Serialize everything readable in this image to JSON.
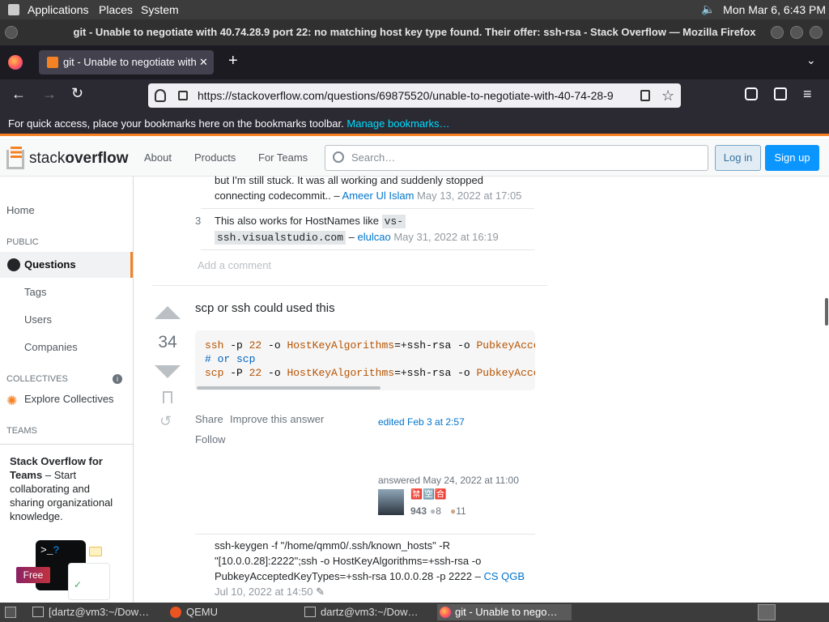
{
  "os_panel": {
    "applications": "Applications",
    "places": "Places",
    "system": "System",
    "clock": "Mon Mar  6,  6:43 PM"
  },
  "window": {
    "title": "git - Unable to negotiate with 40.74.28.9 port 22: no matching host key type found. Their offer: ssh-rsa - Stack Overflow — Mozilla Firefox"
  },
  "browser": {
    "tab_title": "git - Unable to negotiate with",
    "url": "https://stackoverflow.com/questions/69875520/unable-to-negotiate-with-40-74-28-9",
    "bookmark_hint": "For quick access, place your bookmarks here on the bookmarks toolbar.",
    "bookmark_link": "Manage bookmarks…"
  },
  "so": {
    "logo_a": "stack",
    "logo_b": "overflow",
    "nav": [
      "About",
      "Products",
      "For Teams"
    ],
    "search_placeholder": "Search…",
    "login": "Log in",
    "signup": "Sign up"
  },
  "leftnav": {
    "home": "Home",
    "public": "PUBLIC",
    "questions": "Questions",
    "tags": "Tags",
    "users": "Users",
    "companies": "Companies",
    "collectives": "COLLECTIVES",
    "explore": "Explore Collectives",
    "teams": "TEAMS",
    "teams_title": "Stack Overflow for Teams",
    "teams_text": " – Start collaborating and sharing organizational knowledge.",
    "free": "Free"
  },
  "comments": [
    {
      "text_1": "but I'm still stuck. It was all working and suddenly stopped",
      "text_2": "connecting codecommit.. –",
      "user": "Ameer Ul Islam",
      "date": "May 13, 2022 at 17:05"
    },
    {
      "score": "3",
      "text": "This also works for HostNames like",
      "code_1": "vs-",
      "code_2": "ssh.visualstudio.com",
      "dash": "–",
      "user": "elulcao",
      "date": "May 31, 2022 at 16:19"
    }
  ],
  "add_comment": "Add a comment",
  "answer": {
    "votes": "34",
    "intro": "scp or ssh could used this",
    "code_line1": {
      "a": "ssh",
      "b": " -p ",
      "c": "22",
      "d": " -o ",
      "e": "HostKeyAlgorithms",
      "f": "=+ssh-rsa -o ",
      "g": "PubkeyAcce"
    },
    "code_line2": "# or scp",
    "code_line3": {
      "a": "scp",
      "b": " -P ",
      "c": "22",
      "d": " -o ",
      "e": "HostKeyAlgorithms",
      "f": "=+ssh-rsa -o ",
      "g": "PubkeyAcce"
    },
    "share": "Share",
    "improve": "Improve this answer",
    "follow": "Follow",
    "edited": "edited Feb 3 at 2:57",
    "answered": "answered May 24, 2022 at 11:00",
    "user_glyph": "🈲🈳🈴",
    "rep": "943",
    "silver": "8",
    "bronze": "11"
  },
  "answer_comment": {
    "l1": "ssh-keygen -f \"/home/qmm0/.ssh/known_hosts\" -R",
    "l2": "\"[10.0.0.28]:2222\";ssh -o HostKeyAlgorithms=+ssh-rsa -o",
    "l3": "PubkeyAcceptedKeyTypes=+ssh-rsa 10.0.0.28 -p 2222 –",
    "user": "CS QGB",
    "date": "Jul 10, 2022 at 14:50"
  },
  "taskbar": [
    "[dartz@vm3:~/Dow…",
    "QEMU",
    "dartz@vm3:~/Dow…",
    "git - Unable to nego…"
  ]
}
